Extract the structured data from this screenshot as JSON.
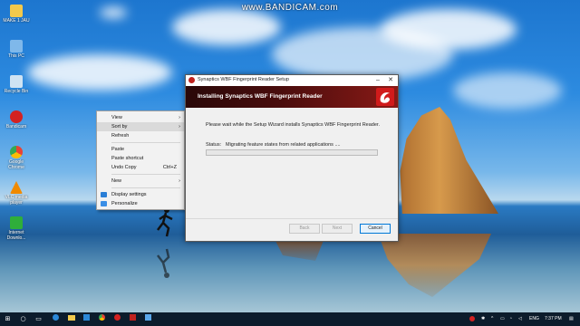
{
  "watermark": "www.BANDICAM.com",
  "desktop": {
    "icons": [
      {
        "label": "MAKE 1 JAU",
        "color": "#f2c94c",
        "icon": "folder-icon"
      },
      {
        "label": "This PC",
        "color": "#7fb8ea",
        "icon": "computer-icon"
      },
      {
        "label": "Recycle Bin",
        "color": "#cfe3f3",
        "icon": "recycle-bin-icon"
      },
      {
        "label": "Bandicam",
        "color": "#d32222",
        "icon": "bandicam-icon"
      },
      {
        "label": "Google Chrome",
        "color": "#e84335",
        "icon": "chrome-icon"
      },
      {
        "label": "VLC media player",
        "color": "#f08a00",
        "icon": "vlc-icon"
      },
      {
        "label": "Internet Downlo...",
        "color": "#2fae3a",
        "icon": "idm-icon"
      }
    ]
  },
  "context_menu": {
    "view": "View",
    "sort_by": "Sort by",
    "refresh": "Refresh",
    "paste": "Paste",
    "paste_shortcut": "Paste shortcut",
    "undo_copy": "Undo Copy",
    "undo_shortcut": "Ctrl+Z",
    "new": "New",
    "display_settings": "Display settings",
    "personalize": "Personalize",
    "arrow": "›"
  },
  "dialog": {
    "title": "Synaptics WBF Fingerprint Reader Setup",
    "banner_title": "Installing Synaptics WBF Fingerprint Reader",
    "wait_text": "Please wait while the Setup Wizard installs Synaptics WBF Fingerprint Reader.",
    "status_label": "Status:",
    "status_value": "Migrating feature states from related applications ....",
    "progress": 0.0,
    "buttons": {
      "back": "Back",
      "next": "Next",
      "cancel": "Cancel"
    },
    "minimize": "–",
    "close": "✕"
  },
  "taskbar": {
    "start": "⊞",
    "search": "○",
    "task_view": "▭",
    "time": "7:37 PM",
    "lang": "ENG",
    "chevron": "^"
  }
}
